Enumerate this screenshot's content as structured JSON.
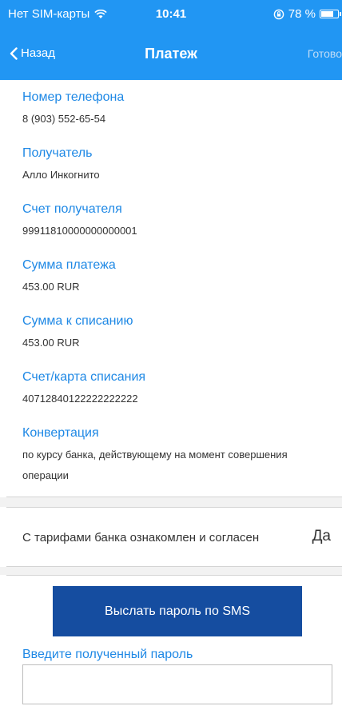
{
  "status_bar": {
    "carrier": "Нет SIM-карты",
    "time": "10:41",
    "battery_text": "78 %",
    "battery_level": 0.78
  },
  "nav": {
    "back_label": "Назад",
    "title": "Платеж",
    "done_label": "Готово"
  },
  "fields": [
    {
      "label": "Номер телефона",
      "value": "8 (903) 552-65-54"
    },
    {
      "label": "Получатель",
      "value": "Алло Инкогнито"
    },
    {
      "label": "Счет получателя",
      "value": "99911810000000000001"
    },
    {
      "label": "Сумма платежа",
      "value": "453.00 RUR"
    },
    {
      "label": "Сумма к списанию",
      "value": "453.00 RUR"
    },
    {
      "label": "Счет/карта списания",
      "value": "40712840122222222222"
    },
    {
      "label": "Конвертация",
      "value": "по курсу банка, действующему на момент совершения операции"
    }
  ],
  "agreement": {
    "text": "С тарифами банка ознакомлен и согласен",
    "answer": "Да"
  },
  "sms": {
    "button_label": "Выслать пароль по SMS",
    "password_label": "Введите полученный пароль",
    "password_value": ""
  },
  "colors": {
    "header": "#2196f3",
    "label": "#1e88e5",
    "button": "#154da0"
  }
}
